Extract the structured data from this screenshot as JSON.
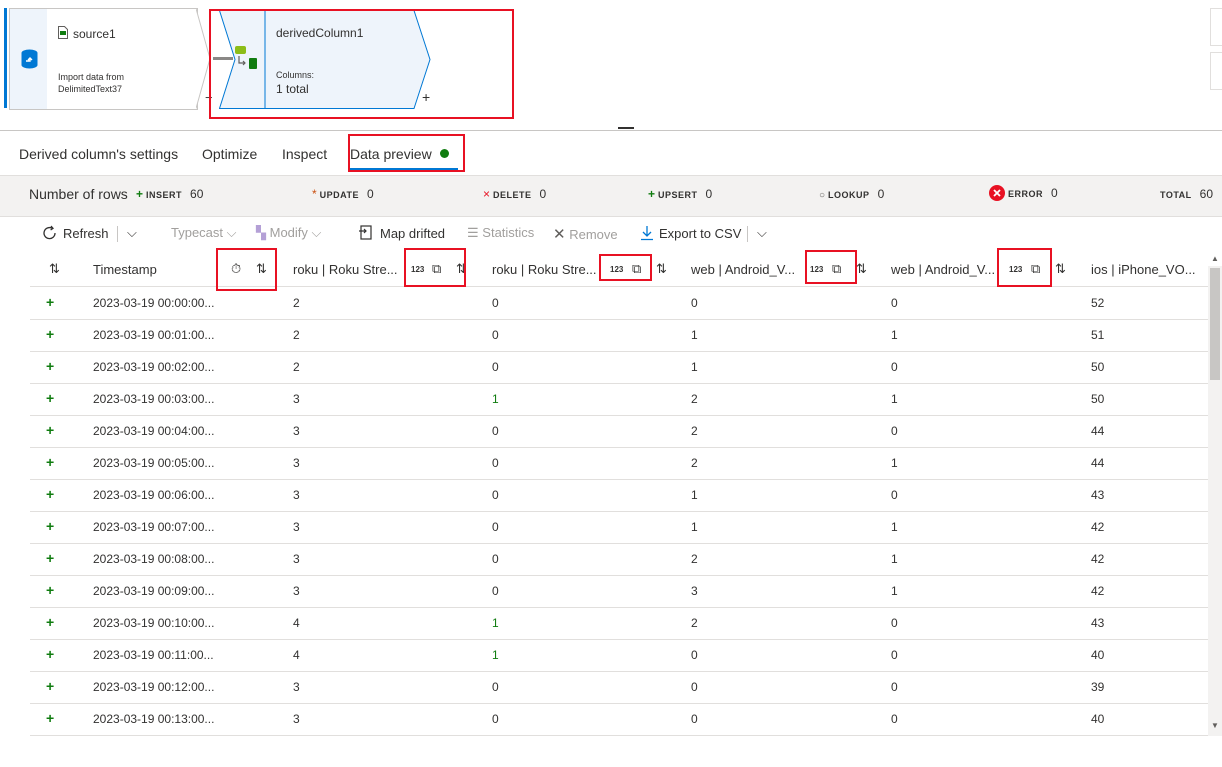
{
  "canvas": {
    "source": {
      "title": "source1",
      "desc_line1": "Import data from",
      "desc_line2": "DelimitedText37"
    },
    "derived": {
      "title": "derivedColumn1",
      "columns_label": "Columns:",
      "columns_value": "1 total"
    },
    "plus": "+",
    "minus": "−"
  },
  "tabs": [
    {
      "label": "Derived column's settings"
    },
    {
      "label": "Optimize"
    },
    {
      "label": "Inspect"
    },
    {
      "label": "Data preview"
    }
  ],
  "stats": {
    "rows_label": "Number of rows",
    "insert": {
      "label": "INSERT",
      "value": "60"
    },
    "update": {
      "label": "UPDATE",
      "value": "0"
    },
    "delete": {
      "label": "DELETE",
      "value": "0"
    },
    "upsert": {
      "label": "UPSERT",
      "value": "0"
    },
    "lookup": {
      "label": "LOOKUP",
      "value": "0"
    },
    "error": {
      "label": "ERROR",
      "value": "0"
    },
    "total": {
      "label": "TOTAL",
      "value": "60"
    }
  },
  "toolbar": {
    "refresh": "Refresh",
    "typecast": "Typecast",
    "modify": "Modify",
    "map_drifted": "Map drifted",
    "statistics": "Statistics",
    "remove": "Remove",
    "export": "Export to CSV"
  },
  "grid": {
    "type_badge": "123",
    "headers": [
      "Timestamp",
      "roku | Roku Stre...",
      "roku | Roku Stre...",
      "web | Android_V...",
      "web | Android_V...",
      "ios | iPhone_VO..."
    ],
    "rows": [
      [
        "2023-03-19 00:00:00...",
        "2",
        "0",
        "0",
        "0",
        "52"
      ],
      [
        "2023-03-19 00:01:00...",
        "2",
        "0",
        "1",
        "1",
        "51"
      ],
      [
        "2023-03-19 00:02:00...",
        "2",
        "0",
        "1",
        "0",
        "50"
      ],
      [
        "2023-03-19 00:03:00...",
        "3",
        "1",
        "2",
        "1",
        "50"
      ],
      [
        "2023-03-19 00:04:00...",
        "3",
        "0",
        "2",
        "0",
        "44"
      ],
      [
        "2023-03-19 00:05:00...",
        "3",
        "0",
        "2",
        "1",
        "44"
      ],
      [
        "2023-03-19 00:06:00...",
        "3",
        "0",
        "1",
        "0",
        "43"
      ],
      [
        "2023-03-19 00:07:00...",
        "3",
        "0",
        "1",
        "1",
        "42"
      ],
      [
        "2023-03-19 00:08:00...",
        "3",
        "0",
        "2",
        "1",
        "42"
      ],
      [
        "2023-03-19 00:09:00...",
        "3",
        "0",
        "3",
        "1",
        "42"
      ],
      [
        "2023-03-19 00:10:00...",
        "4",
        "1",
        "2",
        "0",
        "43"
      ],
      [
        "2023-03-19 00:11:00...",
        "4",
        "1",
        "0",
        "0",
        "40"
      ],
      [
        "2023-03-19 00:12:00...",
        "3",
        "0",
        "0",
        "0",
        "39"
      ],
      [
        "2023-03-19 00:13:00...",
        "3",
        "0",
        "0",
        "0",
        "40"
      ]
    ]
  },
  "colors": {
    "accent": "#0078d4",
    "highlight": "#e81123",
    "insert_green": "#107c10"
  }
}
